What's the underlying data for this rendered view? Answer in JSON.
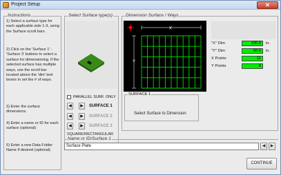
{
  "window": {
    "title": "Project Setup",
    "close_label": "✕"
  },
  "instructions": {
    "title": "Instructions",
    "steps": [
      "1) Select a surface type for each applicable side 1-3, using the Surface scroll bars.",
      "2) Click on the 'Surface 1' - 'Surface 3' buttons to select a surface for dimensioning. If the selected surface has multiple ways, use the scroll bar located above the 'dim' text boxes to set the # of ways.",
      "3) Enter the surface dimensions.",
      "4) Enter a name or ID for each surface (optional)",
      "5) Enter a new Data Folder Name if desired (optional)"
    ]
  },
  "select_surface": {
    "title": "Select Surface type(s)",
    "parallel_label": "PARALLEL SURF. ONLY",
    "parallel_checked": false,
    "surfaces": [
      {
        "label": "SURFACE 1",
        "active": true
      },
      {
        "label": "SURFACE 2",
        "active": false
      },
      {
        "label": "SURFACE 3",
        "active": false
      }
    ],
    "shape_label": "SQUARE/RECTANGULAR",
    "left_arrow": "◀",
    "right_arrow": "▶"
  },
  "dimension": {
    "title": "Dimension Surface / Ways",
    "x_marker": "X",
    "y_marker": "Y",
    "fields": [
      {
        "name": "\"X\" Dim",
        "value": "100.0",
        "unit": "in."
      },
      {
        "name": "\"Y\" Dim",
        "value": "60.0",
        "unit": "in."
      },
      {
        "name": "X Points",
        "value": "11",
        "unit": ""
      },
      {
        "name": "Y Points",
        "value": "6",
        "unit": ""
      }
    ],
    "grid_color": "#00e000",
    "marker_color": "#ff0000",
    "surface_box": {
      "title": "SURFACE 1",
      "message": "Select Surface to Dimension"
    }
  },
  "name_field": {
    "title": "Name or ID/Surface 1",
    "value": "Surface Plate",
    "left_arrow": "◀",
    "right_arrow": "▶"
  },
  "continue_label": "CONTINUE"
}
